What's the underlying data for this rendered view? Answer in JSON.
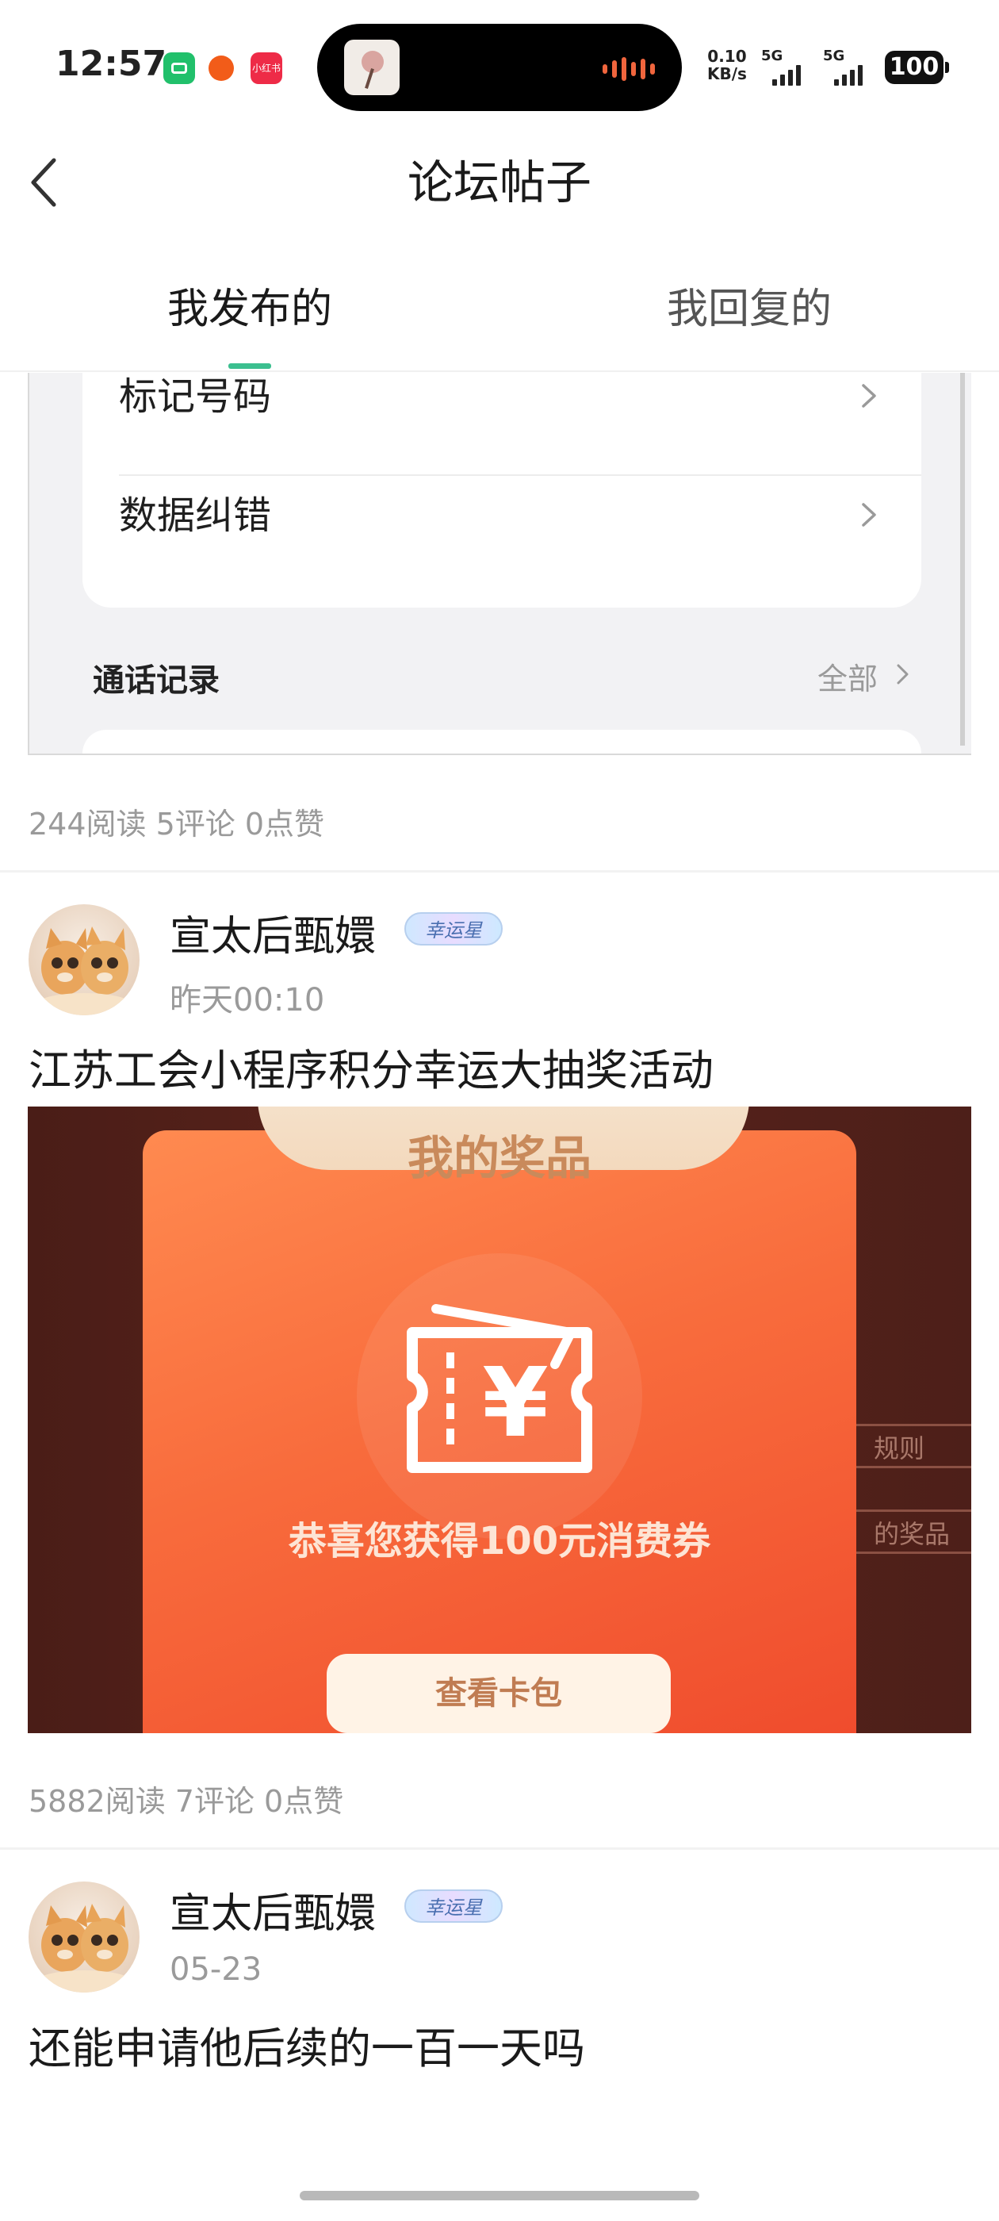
{
  "status_bar": {
    "time": "12:57",
    "net_speed_value": "0.10",
    "net_speed_unit": "KB/s",
    "sim1": "5G",
    "sim2": "5G",
    "battery": "100",
    "red_app_label": "小红书"
  },
  "header": {
    "title": "论坛帖子"
  },
  "tabs": [
    {
      "label": "我发布的",
      "active": true
    },
    {
      "label": "我回复的",
      "active": false
    }
  ],
  "posts": [
    {
      "screenshot": {
        "rows": [
          "标记号码",
          "数据纠错"
        ],
        "section_title": "通话记录",
        "section_action": "全部"
      },
      "stats": "244阅读 5评论 0点赞"
    },
    {
      "author": "宣太后甄嬛",
      "badge": "幸运星",
      "time": "昨天00:10",
      "title": "江苏工会小程序积分幸运大抽奖活动",
      "image": {
        "header_text": "我的奖品",
        "message": "恭喜您获得100元消费券",
        "button": "查看卡包",
        "side_items": [
          "规则",
          "的奖品"
        ]
      },
      "stats": "5882阅读 7评论 0点赞"
    },
    {
      "author": "宣太后甄嬛",
      "badge": "幸运星",
      "time": "05-23",
      "title": "还能申请他后续的一百一天吗"
    }
  ],
  "colors": {
    "accent": "#3bbf8f",
    "prize_orange": "#f86b3c",
    "muted_text": "#9a9a9a"
  }
}
